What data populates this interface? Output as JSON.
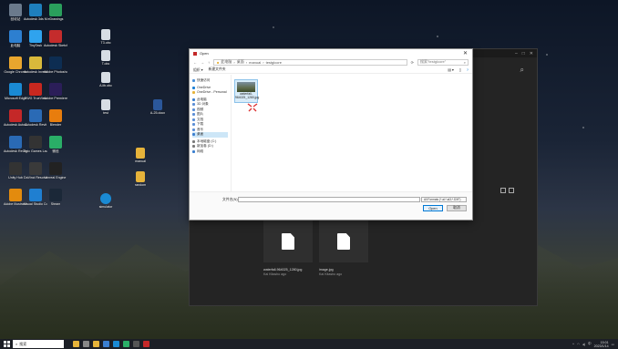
{
  "colors": {
    "accent": "#0078d4",
    "selection": "#cde6f7",
    "taskbar": "#1c1f26",
    "dialog": "#ffffff",
    "app_dark": "#242424"
  },
  "desktop_icons": [
    {
      "label": "回收站",
      "icon": "recycle-bin-icon",
      "color": "#6b7a8c"
    },
    {
      "label": "Autodesk 3ds Max 2024",
      "icon": "3dsmax-icon",
      "color": "#1e7fbd"
    },
    {
      "label": "eDrawings",
      "icon": "edrawings-icon",
      "color": "#2a9f5c"
    },
    {
      "label": "此电脑",
      "icon": "computer-icon",
      "color": "#2d7fd0"
    },
    {
      "label": "TinyTask",
      "icon": "tinytask-icon",
      "color": "#2fa3ee"
    },
    {
      "label": "Autodesk SketchBook",
      "icon": "sketchbook-icon",
      "color": "#c42c2c"
    },
    {
      "label": "Google Chrome",
      "icon": "chrome-icon",
      "color": "#e9a62e"
    },
    {
      "label": "Autodesk Inventor",
      "icon": "inventor-icon",
      "color": "#d9b93b"
    },
    {
      "label": "Adobe Photoshop",
      "icon": "photoshop-icon",
      "color": "#0d2d52"
    },
    {
      "label": "Microsoft Edge",
      "icon": "edge-icon",
      "color": "#1a8ad4"
    },
    {
      "label": "DWG TrueView",
      "icon": "dwg-icon",
      "color": "#c8281f"
    },
    {
      "label": "Adobe Premiere",
      "icon": "premiere-icon",
      "color": "#2b1e58"
    },
    {
      "label": "Autodesk AutoCad",
      "icon": "autocad-icon",
      "color": "#c42828"
    },
    {
      "label": "Autodesk Revit",
      "icon": "revit-icon",
      "color": "#2a6ab5"
    },
    {
      "label": "Blender",
      "icon": "blender-icon",
      "color": "#e87d0d"
    },
    {
      "label": "Autodesk ReCap",
      "icon": "recap-icon",
      "color": "#2a6ab5"
    },
    {
      "label": "Epic Games Launcher",
      "icon": "epic-icon",
      "color": "#333"
    },
    {
      "label": "微信",
      "icon": "wechat-icon",
      "color": "#2aae67"
    },
    {
      "label": "Unity Hub",
      "icon": "unity-icon",
      "color": "#333"
    },
    {
      "label": "DaVinci Resolve",
      "icon": "davinci-icon",
      "color": "#3a3a3a"
    },
    {
      "label": "Unreal Engine",
      "icon": "unreal-icon",
      "color": "#222"
    },
    {
      "label": "Adobe Illustrator",
      "icon": "illustrator-icon",
      "color": "#e38b0e"
    },
    {
      "label": "Visual Studio Code",
      "icon": "vscode-icon",
      "color": "#1f7fd1"
    },
    {
      "label": "Steam",
      "icon": "steam-icon",
      "color": "#1b2838"
    }
  ],
  "desktop_files": [
    {
      "label": "T3.obc",
      "icon": "file-icon"
    },
    {
      "label": "T.obc",
      "icon": "file-icon"
    },
    {
      "label": "A.lib.obc",
      "icon": "file-icon"
    },
    {
      "label": "test",
      "icon": "file-icon"
    },
    {
      "label": "A-25.docx",
      "icon": "word-icon"
    },
    {
      "label": "manual",
      "icon": "folder-icon"
    },
    {
      "label": "random",
      "icon": "folder-icon"
    },
    {
      "label": "simulator",
      "icon": "edge-icon"
    }
  ],
  "dialog": {
    "title": "Open",
    "close": "✕",
    "path": [
      "此电脑",
      "桌面",
      "manual",
      "testglcore"
    ],
    "search_placeholder": "搜索\"testglcore\"",
    "cmd_organize": "组织 ▾",
    "cmd_new_folder": "新建文件夹",
    "nav": [
      {
        "label": "快速访问",
        "color": "#4a90d9"
      },
      {
        "label": "OneDrive",
        "color": "#1a7fd6"
      },
      {
        "label": "OneDrive - Personal",
        "color": "#e6b33a"
      },
      {
        "label": "此电脑",
        "color": "#3b7fd0"
      },
      {
        "label": "3D 对象",
        "color": "#5c8fd6"
      },
      {
        "label": "视频",
        "color": "#5c8fd6"
      },
      {
        "label": "图片",
        "color": "#5c8fd6"
      },
      {
        "label": "文档",
        "color": "#5c8fd6"
      },
      {
        "label": "下载",
        "color": "#5c8fd6"
      },
      {
        "label": "音乐",
        "color": "#5c8fd6"
      },
      {
        "label": "桌面",
        "color": "#3b7fd0"
      },
      {
        "label": "本地磁盘 (C:)",
        "color": "#7a7a7a"
      },
      {
        "label": "新加卷 (D:)",
        "color": "#7a7a7a"
      },
      {
        "label": "网络",
        "color": "#3b7fd0"
      }
    ],
    "file": {
      "name": "waterfall-964025_1280.jpg"
    },
    "filename_label": "文件名(N):",
    "filetype": "All Formats (*.ai;*.ai3;*.DXF)",
    "open_label": "Open",
    "cancel_label": "取消"
  },
  "app": {
    "tiles": [
      {
        "name": "waterfall-964025_1280.jpg",
        "sub": "Kai Kitasho ago"
      },
      {
        "name": "image.jpg",
        "sub": "Kai Kitasho ago"
      }
    ]
  },
  "taskbar": {
    "search_placeholder": "搜索",
    "time": "15:01",
    "date": "2023/1/14",
    "lang": "中"
  }
}
